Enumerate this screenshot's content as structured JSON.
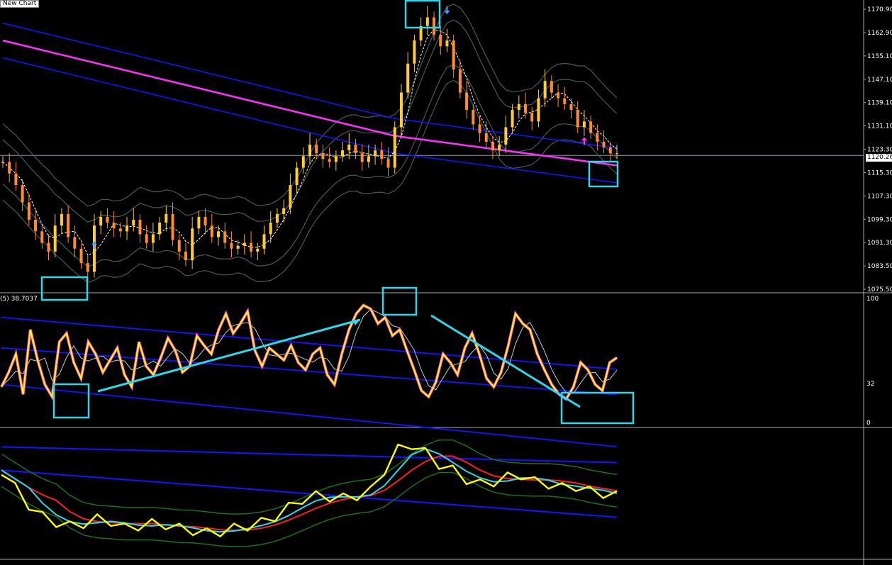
{
  "window": {
    "title": "New Chart"
  },
  "price_panel": {
    "current_price_label": "1120.26",
    "axis_labels": [
      "1170.90",
      "1162.90",
      "1155.10",
      "1147.10",
      "1139.10",
      "1131.10",
      "1123.30",
      "1115.30",
      "1107.30",
      "1099.30",
      "1091.30",
      "1083.50",
      "1075.50"
    ]
  },
  "rsi_panel": {
    "label": "(5) 38.7037",
    "axis_labels": [
      "100",
      "32",
      "0"
    ]
  },
  "colors": {
    "background": "#000000",
    "magenta": "#ff33ff",
    "blue": "#1515ff",
    "grey_band": "#4a5a5a",
    "candle_up": "#ffcc33",
    "candle_down": "#ff8c33",
    "yellow": "#ffff00",
    "cyan": "#33d6e6",
    "red": "#ff2020",
    "green": "#1e6e1e"
  },
  "icons": [
    "up-arrow-icon",
    "down-arrow-icon"
  ],
  "chart_data": [
    {
      "type": "candlestick",
      "title": "",
      "ylim": [
        1073,
        1174
      ],
      "current_price": 1120.26,
      "close_path": [
        1118,
        1114,
        1110,
        1104,
        1098,
        1094,
        1090,
        1087,
        1096,
        1100,
        1092,
        1088,
        1083,
        1080,
        1096,
        1099,
        1097,
        1095,
        1094,
        1096,
        1098,
        1093,
        1090,
        1093,
        1097,
        1100,
        1091,
        1087,
        1084,
        1095,
        1099,
        1096,
        1092,
        1094,
        1090,
        1088,
        1089,
        1090,
        1087,
        1088,
        1093,
        1097,
        1100,
        1102,
        1110,
        1116,
        1120,
        1124,
        1121,
        1119,
        1118,
        1120,
        1122,
        1124,
        1121,
        1118,
        1120,
        1122,
        1119,
        1116,
        1130,
        1142,
        1152,
        1160,
        1165,
        1168,
        1162,
        1158,
        1160,
        1150,
        1142,
        1136,
        1131,
        1128,
        1125,
        1122,
        1124,
        1130,
        1136,
        1138,
        1135,
        1132,
        1140,
        1146,
        1142,
        1140,
        1138,
        1136,
        1130,
        1132,
        1128,
        1125,
        1123,
        1121,
        1121
      ],
      "signals": [
        {
          "type": "buy",
          "bar": 14
        },
        {
          "type": "sell",
          "bar": 68
        },
        {
          "type": "buy",
          "bar": 89
        }
      ]
    },
    {
      "type": "line",
      "title": "",
      "ylim": [
        0,
        100
      ],
      "series": [
        {
          "values": [
            28,
            40,
            55,
            22,
            75,
            50,
            30,
            20,
            65,
            72,
            48,
            35,
            65,
            55,
            40,
            50,
            60,
            38,
            28,
            65,
            45,
            38,
            52,
            68,
            58,
            40,
            45,
            70,
            62,
            55,
            75,
            88,
            72,
            80,
            90,
            58,
            45,
            60,
            55,
            50,
            62,
            48,
            42,
            55,
            60,
            38,
            30,
            55,
            75,
            88,
            95,
            92,
            80,
            85,
            70,
            75,
            58,
            42,
            25,
            20,
            32,
            55,
            48,
            38,
            60,
            72,
            55,
            35,
            28,
            40,
            62,
            88,
            80,
            75,
            55,
            42,
            30,
            22,
            18,
            28,
            48,
            42,
            30,
            25,
            48,
            52
          ]
        }
      ]
    },
    {
      "type": "line",
      "title": "",
      "series": [
        {
          "values": [
            70,
            55,
            40,
            30,
            25,
            22,
            24,
            28,
            26,
            20,
            22,
            24,
            23,
            20,
            18,
            16,
            17,
            20,
            22,
            25,
            30,
            38,
            45,
            48,
            47,
            46,
            48,
            52,
            70,
            88,
            92,
            85,
            75,
            70,
            62,
            58,
            60,
            64,
            66,
            60,
            58,
            55,
            56,
            52,
            50,
            48
          ]
        }
      ]
    }
  ]
}
